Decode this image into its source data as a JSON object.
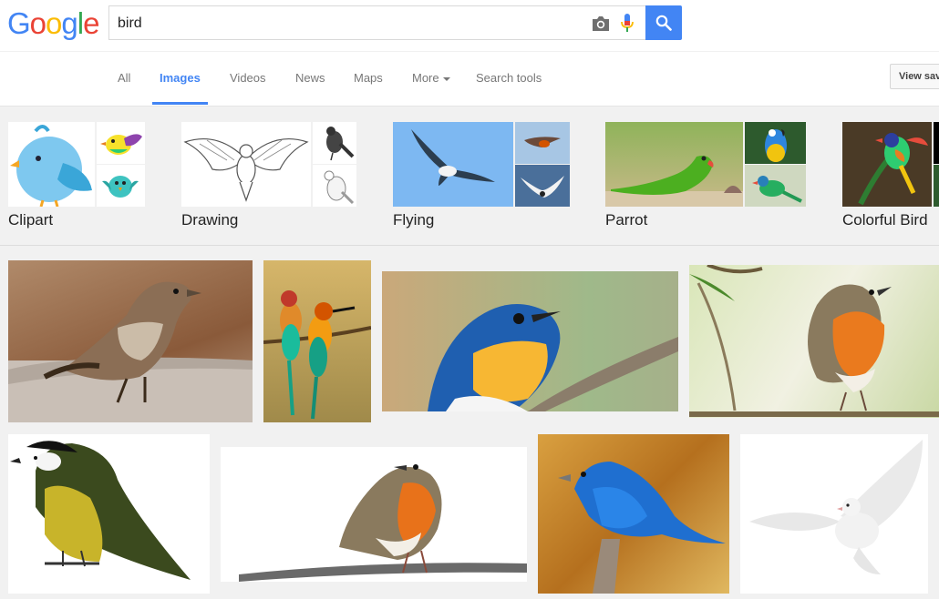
{
  "logo": {
    "letters": [
      "G",
      "o",
      "o",
      "g",
      "l",
      "e"
    ]
  },
  "search": {
    "query": "bird"
  },
  "nav": {
    "all": "All",
    "images": "Images",
    "videos": "Videos",
    "news": "News",
    "maps": "Maps",
    "more": "More",
    "search_tools": "Search tools",
    "view_saved": "View saved"
  },
  "related": [
    {
      "label": "Clipart"
    },
    {
      "label": "Drawing"
    },
    {
      "label": "Flying"
    },
    {
      "label": "Parrot"
    },
    {
      "label": "Colorful Bird"
    }
  ],
  "colors": {
    "accent": "#4285f4",
    "logo_blue": "#4285f4",
    "logo_red": "#ea4335",
    "logo_yellow": "#fbbc05",
    "logo_green": "#34a853"
  },
  "icons": [
    "camera-icon",
    "mic-icon",
    "search-icon",
    "chevron-down-icon"
  ]
}
